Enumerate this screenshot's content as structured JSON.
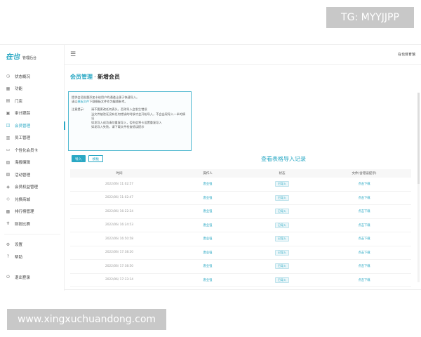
{
  "brand": {
    "logo": "在也",
    "subtitle": "管理后台"
  },
  "sidebar": {
    "items": [
      {
        "label": "状态概况",
        "icon": "clock-icon",
        "glyph": "◷"
      },
      {
        "label": "功能",
        "icon": "grid-icon",
        "glyph": "▦"
      },
      {
        "label": "门店",
        "icon": "store-icon",
        "glyph": "▤"
      },
      {
        "label": "审计跟踪",
        "icon": "audit-icon",
        "glyph": "▣"
      },
      {
        "label": "会员管理",
        "icon": "member-icon",
        "glyph": "◫",
        "active": true
      },
      {
        "label": "员工管理",
        "icon": "staff-icon",
        "glyph": "▥"
      },
      {
        "label": "个性化会员卡",
        "icon": "card-icon",
        "glyph": "▭"
      },
      {
        "label": "海报编辑",
        "icon": "poster-icon",
        "glyph": "▧"
      },
      {
        "label": "活动管理",
        "icon": "activity-icon",
        "glyph": "▨"
      },
      {
        "label": "会员权益管理",
        "icon": "benefit-icon",
        "glyph": "◈"
      },
      {
        "label": "兑换商城",
        "icon": "mall-icon",
        "glyph": "◇"
      },
      {
        "label": "排行榜管理",
        "icon": "ranking-icon",
        "glyph": "▩"
      },
      {
        "label": "财担比赛",
        "icon": "trophy-icon",
        "glyph": "♆"
      }
    ],
    "bottom_items": [
      {
        "label": "设置",
        "icon": "gear-icon",
        "glyph": "⚙"
      },
      {
        "label": "帮助",
        "icon": "help-icon",
        "glyph": "?"
      }
    ],
    "logout": {
      "label": "退出登录",
      "icon": "logout-icon",
      "glyph": "⏻"
    }
  },
  "topbar": {
    "menu_glyph": "☰",
    "user": "在也体育馆"
  },
  "page": {
    "crumb": "会员管理",
    "separator": "·",
    "title": "新增会员"
  },
  "notice": {
    "line1": "提供会员批量添加卡给用户的通道让便于快速导入。",
    "line2_pre": "请以",
    "line2_link": "模板文件",
    "line2_post": "下载模板文件作为编辑参考。",
    "tips_label": "注意提示:",
    "tips": [
      "请不要更改任何表头，否则导入会发生错误",
      "当文件被验证没有任何错误的时候才会开始导入，不会出现导入一半的情况",
      "如发导入成功请勿重复导入，否则会将卡设置重复导入",
      "如发导入失败，请下载文件检查错误提示"
    ]
  },
  "buttons": {
    "import": "导入",
    "download": "模板"
  },
  "records": {
    "title": "查看表格导入记录",
    "headers": [
      "时间",
      "操作人",
      "状态",
      "文件(含错误提示)"
    ],
    "rows": [
      [
        "2022/06/ 11:02:57",
        "唐业强",
        "已导入",
        "点击下载"
      ],
      [
        "2022/06/ 11:02:47",
        "唐业强",
        "已导入",
        "点击下载"
      ],
      [
        "2022/06/ 16:22:24",
        "唐业强",
        "已导入",
        "点击下载"
      ],
      [
        "2022/06/ 16:24:53",
        "唐业强",
        "已导入",
        "点击下载"
      ],
      [
        "2022/06/ 16:50:58",
        "唐业强",
        "已导入",
        "点击下载"
      ],
      [
        "2022/06/ 17:38:20",
        "唐业强",
        "已导入",
        "点击下载"
      ],
      [
        "2022/06/ 17:38:50",
        "唐业强",
        "已导入",
        "点击下载"
      ],
      [
        "2022/06/ 17:33:14",
        "唐业强",
        "已导入",
        "点击下载"
      ]
    ]
  },
  "watermarks": {
    "top": "TG: MYYJJPP",
    "bottom": "www.xingxuchuandong.com"
  },
  "colors": {
    "accent": "#2aa8c4"
  }
}
